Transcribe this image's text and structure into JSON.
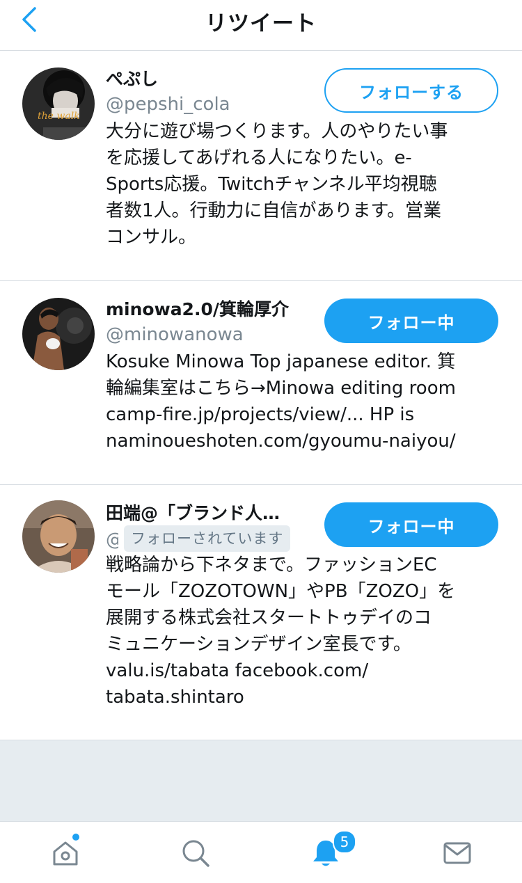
{
  "header": {
    "title": "リツイート",
    "back_icon": "chevron-left-icon"
  },
  "colors": {
    "accent": "#1da1f2",
    "text": "#14171a",
    "muted": "#7a8791",
    "divider": "#d7dde2",
    "background_gray": "#e6ecf0"
  },
  "users": [
    {
      "name": "ぺぷし",
      "handle": "@pepshi_cola",
      "follow_label": "フォローする",
      "follow_state": "not-following",
      "bio_lines": [
        "大分に遊び場つくります。人のやりたい事",
        "を応援してあげれる人になりたい。e-",
        "Sports応援。Twitchチャンネル平均視聴",
        "者数1人。行動力に自信があります。営業",
        "コンサル。"
      ]
    },
    {
      "name": "minowa2.0/箕輪厚介",
      "handle": "@minowanowa",
      "follow_label": "フォロー中",
      "follow_state": "following",
      "bio_lines": [
        "Kosuke Minowa Top japanese editor. 箕",
        "輪編集室はこちら→Minowa editing room",
        "camp-fire.jp/projects/view/... HP is",
        "naminoueshoten.com/gyoumu-naiyou/"
      ]
    },
    {
      "name": "田端@「ブランド人…",
      "handle": "@",
      "follows_you": "フォローされています",
      "follow_label": "フォロー中",
      "follow_state": "following",
      "bio_lines": [
        "戦略論から下ネタまで。ファッションEC",
        "モール「ZOZOTOWN」やPB「ZOZO」を",
        "展開する株式会社スタートトゥデイのコ",
        "ミュニケーションデザイン室長です。",
        "valu.is/tabata facebook.com/",
        "tabata.shintaro"
      ]
    }
  ],
  "tabbar": {
    "tabs": [
      {
        "icon": "home-icon",
        "indicator": "dot"
      },
      {
        "icon": "search-icon"
      },
      {
        "icon": "bell-icon",
        "badge": "5"
      },
      {
        "icon": "mail-icon"
      }
    ]
  }
}
